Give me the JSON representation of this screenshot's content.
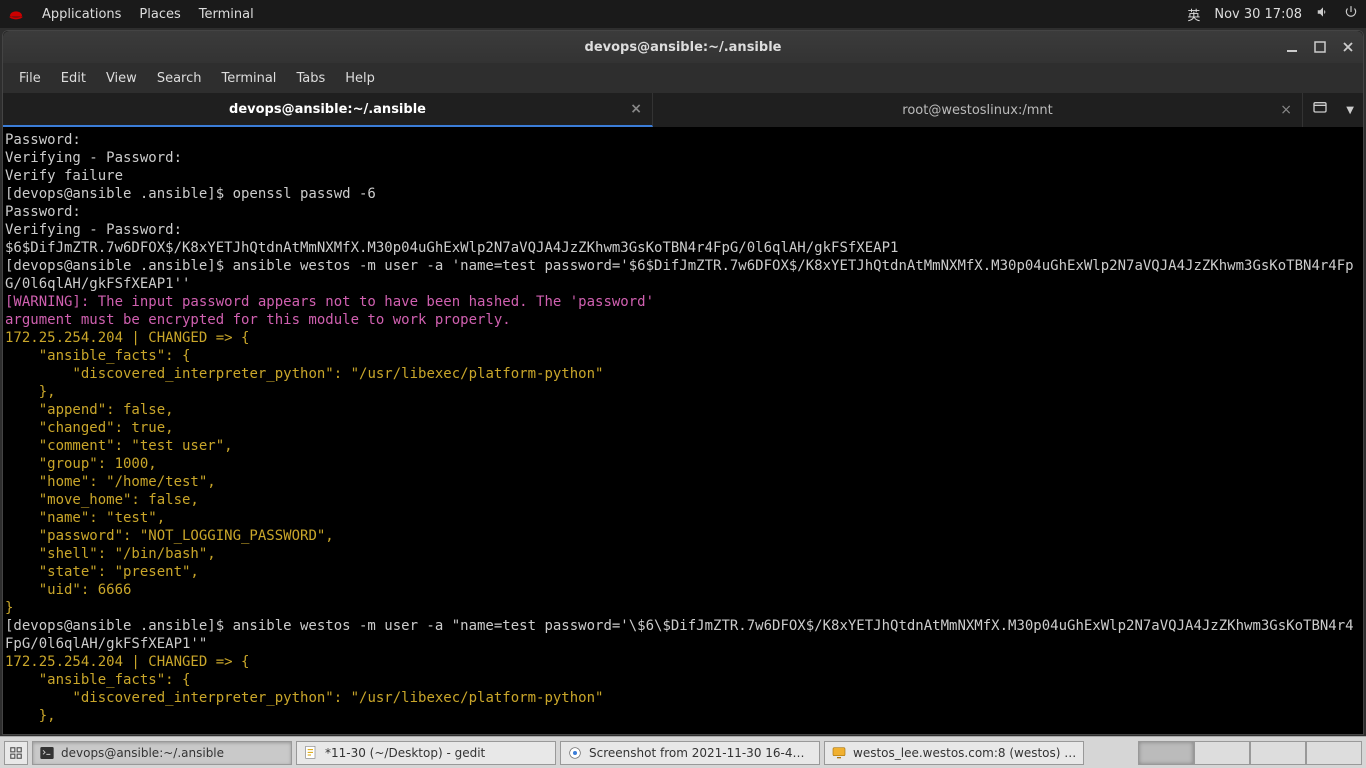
{
  "top_panel": {
    "applications": "Applications",
    "places": "Places",
    "terminal": "Terminal",
    "ime": "英",
    "clock": "Nov 30  17:08"
  },
  "window": {
    "title": "devops@ansible:~/.ansible",
    "menus": {
      "file": "File",
      "edit": "Edit",
      "view": "View",
      "search": "Search",
      "terminal": "Terminal",
      "tabs": "Tabs",
      "help": "Help"
    },
    "tabs": [
      {
        "label": "devops@ansible:~/.ansible",
        "active": true
      },
      {
        "label": "root@westoslinux:/mnt",
        "active": false
      }
    ]
  },
  "terminal": {
    "lines": [
      {
        "cls": "",
        "text": "Password: "
      },
      {
        "cls": "",
        "text": "Verifying - Password: "
      },
      {
        "cls": "",
        "text": "Verify failure"
      },
      {
        "cls": "",
        "text": "[devops@ansible .ansible]$ openssl passwd -6"
      },
      {
        "cls": "",
        "text": "Password: "
      },
      {
        "cls": "",
        "text": "Verifying - Password: "
      },
      {
        "cls": "",
        "text": "$6$DifJmZTR.7w6DFOX$/K8xYETJhQtdnAtMmNXMfX.M30p04uGhExWlp2N7aVQJA4JzZKhwm3GsKoTBN4r4FpG/0l6qlAH/gkFSfXEAP1"
      },
      {
        "cls": "",
        "text": "[devops@ansible .ansible]$ ansible westos -m user -a 'name=test password='$6$DifJmZTR.7w6DFOX$/K8xYETJhQtdnAtMmNXMfX.M30p04uGhExWlp2N7aVQJA4JzZKhwm3GsKoTBN4r4FpG/0l6qlAH/gkFSfXEAP1''"
      },
      {
        "cls": "pink",
        "text": "[WARNING]: The input password appears not to have been hashed. The 'password'"
      },
      {
        "cls": "pink",
        "text": "argument must be encrypted for this module to work properly."
      },
      {
        "cls": "yellow",
        "text": "172.25.254.204 | CHANGED => {"
      },
      {
        "cls": "yellow",
        "text": "    \"ansible_facts\": {"
      },
      {
        "cls": "yellow",
        "text": "        \"discovered_interpreter_python\": \"/usr/libexec/platform-python\""
      },
      {
        "cls": "yellow",
        "text": "    },"
      },
      {
        "cls": "yellow",
        "text": "    \"append\": false,"
      },
      {
        "cls": "yellow",
        "text": "    \"changed\": true,"
      },
      {
        "cls": "yellow",
        "text": "    \"comment\": \"test user\","
      },
      {
        "cls": "yellow",
        "text": "    \"group\": 1000,"
      },
      {
        "cls": "yellow",
        "text": "    \"home\": \"/home/test\","
      },
      {
        "cls": "yellow",
        "text": "    \"move_home\": false,"
      },
      {
        "cls": "yellow",
        "text": "    \"name\": \"test\","
      },
      {
        "cls": "yellow",
        "text": "    \"password\": \"NOT_LOGGING_PASSWORD\","
      },
      {
        "cls": "yellow",
        "text": "    \"shell\": \"/bin/bash\","
      },
      {
        "cls": "yellow",
        "text": "    \"state\": \"present\","
      },
      {
        "cls": "yellow",
        "text": "    \"uid\": 6666"
      },
      {
        "cls": "yellow",
        "text": "}"
      },
      {
        "cls": "",
        "text": "[devops@ansible .ansible]$ ansible westos -m user -a \"name=test password='\\$6\\$DifJmZTR.7w6DFOX$/K8xYETJhQtdnAtMmNXMfX.M30p04uGhExWlp2N7aVQJA4JzZKhwm3GsKoTBN4r4FpG/0l6qlAH/gkFSfXEAP1'\""
      },
      {
        "cls": "yellow",
        "text": "172.25.254.204 | CHANGED => {"
      },
      {
        "cls": "yellow",
        "text": "    \"ansible_facts\": {"
      },
      {
        "cls": "yellow",
        "text": "        \"discovered_interpreter_python\": \"/usr/libexec/platform-python\""
      },
      {
        "cls": "yellow",
        "text": "    },"
      }
    ]
  },
  "bottom_panel": {
    "tasks": [
      {
        "label": "devops@ansible:~/.ansible",
        "icon": "terminal"
      },
      {
        "label": "*11-30 (~/Desktop) - gedit",
        "icon": "gedit"
      },
      {
        "label": "Screenshot from 2021-11-30 16-4…",
        "icon": "eye"
      },
      {
        "label": "westos_lee.westos.com:8 (westos) …",
        "icon": "remote"
      }
    ]
  }
}
